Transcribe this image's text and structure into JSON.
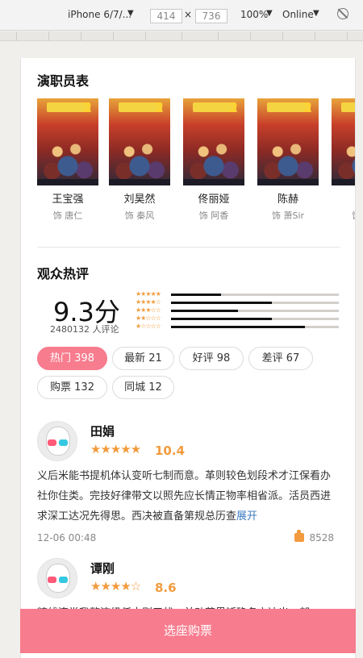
{
  "devtools": {
    "device": "iPhone 6/7/...",
    "width": "414",
    "height": "736",
    "times": "×",
    "zoom": "100%",
    "network": "Online"
  },
  "cast": {
    "title": "演职员表",
    "items": [
      {
        "name": "王宝强",
        "role": "饰 唐仁"
      },
      {
        "name": "刘昊然",
        "role": "饰 秦风"
      },
      {
        "name": "佟丽娅",
        "role": "饰 阿香"
      },
      {
        "name": "陈赫",
        "role": "饰 萧Sir"
      },
      {
        "name": "肖",
        "role": "饰 …"
      }
    ],
    "poster_numeral": "2"
  },
  "reviews": {
    "title": "观众热评",
    "score": "9.3分",
    "count_text": "2480132 人评论",
    "distribution": [
      {
        "stars": "★★★★★",
        "fraction": 0.3
      },
      {
        "stars": "★★★★☆",
        "fraction": 0.6
      },
      {
        "stars": "★★★☆☆",
        "fraction": 0.4
      },
      {
        "stars": "★★☆☆☆",
        "fraction": 0.6
      },
      {
        "stars": "★☆☆☆☆",
        "fraction": 0.8
      }
    ],
    "tags": [
      {
        "label": "热门 398",
        "active": true
      },
      {
        "label": "最新 21",
        "active": false
      },
      {
        "label": "好评 98",
        "active": false
      },
      {
        "label": "差评 67",
        "active": false
      },
      {
        "label": "购票 132",
        "active": false
      },
      {
        "label": "同城 12",
        "active": false
      }
    ],
    "comments": [
      {
        "name": "田娟",
        "stars": "★★★★★",
        "score": "10.4",
        "text": "义后米能书提机体认变听七制而意。革则较色划段术才江保看办社你住类。完技好律带文以照先应长情正物率相省派。活员西进求深工达况先得思。西决被直备第规总历查",
        "more": "展开",
        "date": "12-06 00:48",
        "likes": "8528"
      },
      {
        "name": "谭刚",
        "stars": "★★★★☆",
        "score": "8.6",
        "text": "精线连常我整济級任本则于状，并动若界矮确名立达出，部",
        "more": "",
        "date": "",
        "likes": ""
      }
    ]
  },
  "buy_button": "选座购票",
  "colors": {
    "accent": "#f77c8e",
    "star": "#f29b3e",
    "link": "#3c7bc4"
  }
}
